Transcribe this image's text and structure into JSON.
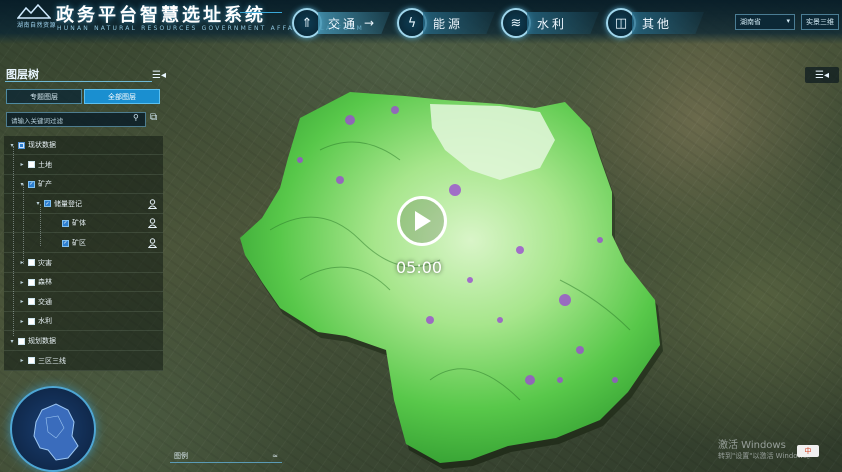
{
  "header": {
    "logo_small_text": "湖南自然资源",
    "title": "政务平台智慧选址系统",
    "subtitle": "HUNAN NATURAL RESOURCES GOVERNMENT AFFAIRS PLATFORM",
    "nav": [
      {
        "label": "交通",
        "icon": "road-icon",
        "glyph": "🛣",
        "arrow": "→"
      },
      {
        "label": "能源",
        "icon": "energy-icon",
        "glyph": "⚡"
      },
      {
        "label": "水利",
        "icon": "water-icon",
        "glyph": "💧"
      },
      {
        "label": "其他",
        "icon": "other-icon",
        "glyph": "⋯"
      }
    ],
    "region_select": "湖南省",
    "view_toggle": "实景三维"
  },
  "layer_panel": {
    "title": "图层树",
    "tab_special": "专题图层",
    "tab_all": "全部图层",
    "search_placeholder": "请输入关键词过滤",
    "tree": [
      {
        "label": "现状数据",
        "level": 0,
        "state": "partial",
        "expander": "▾"
      },
      {
        "label": "土地",
        "level": 1,
        "state": "unchecked",
        "expander": "▸"
      },
      {
        "label": "矿产",
        "level": 1,
        "state": "checked",
        "expander": "▾"
      },
      {
        "label": "储量登记",
        "level": 2,
        "state": "checked",
        "expander": "▾",
        "user": true
      },
      {
        "label": "矿体",
        "level": 3,
        "state": "checked",
        "expander": "",
        "user": true
      },
      {
        "label": "矿区",
        "level": 3,
        "state": "checked",
        "expander": "",
        "user": true
      },
      {
        "label": "灾害",
        "level": 1,
        "state": "unchecked",
        "expander": "▸"
      },
      {
        "label": "森林",
        "level": 1,
        "state": "unchecked",
        "expander": "▸"
      },
      {
        "label": "交通",
        "level": 1,
        "state": "unchecked",
        "expander": "▸"
      },
      {
        "label": "水利",
        "level": 1,
        "state": "unchecked",
        "expander": "▸"
      },
      {
        "label": "规划数据",
        "level": 0,
        "state": "unchecked",
        "expander": "▾"
      },
      {
        "label": "三区三线",
        "level": 1,
        "state": "unchecked",
        "expander": "▸"
      }
    ]
  },
  "legend": {
    "label": "图例",
    "toggle": "≈"
  },
  "video": {
    "time": "05:00"
  },
  "watermark": {
    "line1": "激活 Windows",
    "line2": "转到\"设置\"以激活 Windows。"
  },
  "ime": {
    "label": "中"
  }
}
